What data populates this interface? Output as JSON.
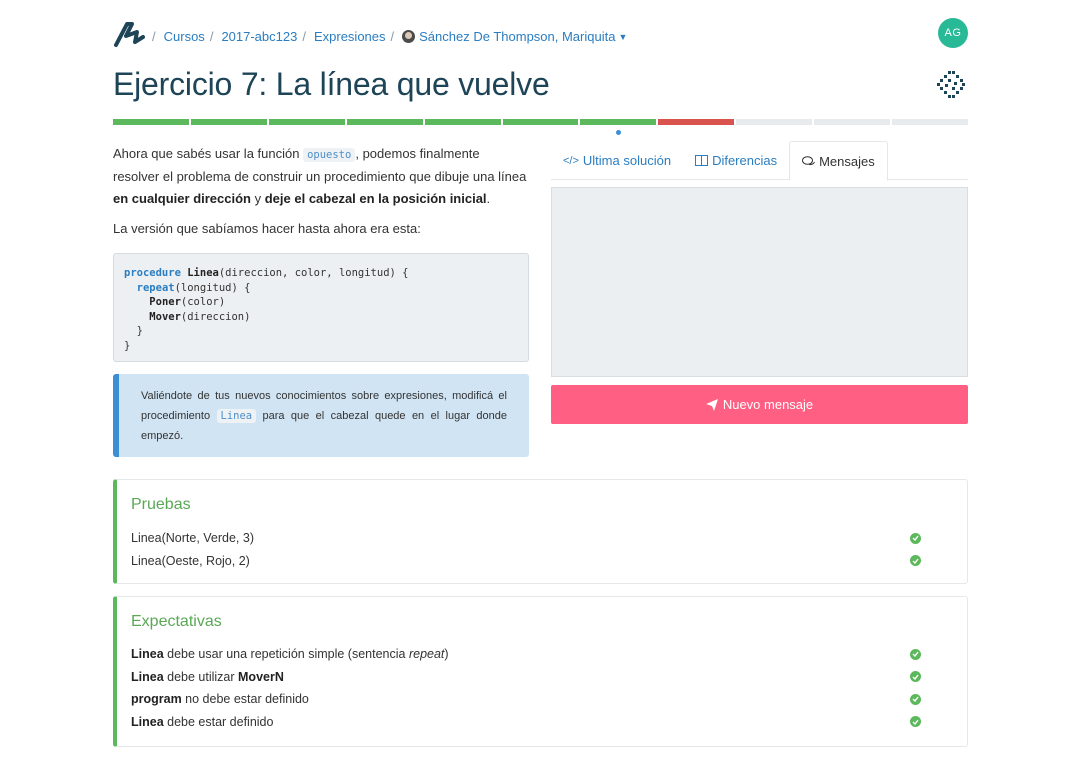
{
  "breadcrumb": {
    "items": [
      "Cursos",
      "2017-abc123",
      "Expresiones"
    ],
    "user": "Sánchez De Thompson, Mariquita"
  },
  "avatar_initials": "AG",
  "title": "Ejercicio 7: La línea que vuelve",
  "progress": {
    "segments": [
      "passed",
      "passed",
      "passed",
      "passed",
      "passed",
      "passed",
      "passed",
      "failed",
      "pending",
      "pending",
      "pending"
    ],
    "current_index": 6,
    "colors": {
      "passed": "#5cb85c",
      "failed": "#d9534f",
      "pending": "#e8ebed"
    }
  },
  "description": {
    "p1_a": "Ahora que sabés usar la función ",
    "p1_code": "opuesto",
    "p1_b": ", podemos finalmente resolver el problema de construir un procedimiento que dibuje una línea ",
    "p1_bold1": "en cualquier dirección",
    "p1_c": " y ",
    "p1_bold2": "deje el cabezal en la posición inicial",
    "p1_d": ".",
    "p2": "La versión que sabíamos hacer hasta ahora era esta:"
  },
  "code": {
    "kw_procedure": "procedure",
    "name": "Linea",
    "params": "(direccion, color, longitud) {",
    "kw_repeat": "repeat",
    "repeat_args": "(longitud) {",
    "fn_poner": "Poner",
    "poner_args": "(color)",
    "fn_mover": "Mover",
    "mover_args": "(direccion)",
    "close_inner": "}",
    "close_outer": "}"
  },
  "info": {
    "a": "Valiéndote de tus nuevos conocimientos sobre expresiones, modificá el procedimiento ",
    "code": "Linea",
    "b": " para que el cabezal quede en el lugar donde empezó."
  },
  "tabs": [
    {
      "label": "Ultima solución",
      "icon": "code-icon",
      "active": false
    },
    {
      "label": "Diferencias",
      "icon": "columns-icon",
      "active": false
    },
    {
      "label": "Mensajes",
      "icon": "comments-icon",
      "active": true
    }
  ],
  "new_message_label": "Nuevo mensaje",
  "tests": {
    "title": "Pruebas",
    "items": [
      "Linea(Norte, Verde, 3)",
      "Linea(Oeste, Rojo, 2)"
    ]
  },
  "expectations": {
    "title": "Expectativas",
    "items": [
      {
        "bold": "Linea",
        "text": " debe usar una repetición simple (sentencia ",
        "italic": "repeat",
        "end": ")"
      },
      {
        "bold": "Linea",
        "text": " debe utilizar ",
        "bold2": "MoverN"
      },
      {
        "bold": "program",
        "text": " no debe estar definido"
      },
      {
        "bold": "Linea",
        "text": " debe estar definido"
      }
    ]
  }
}
